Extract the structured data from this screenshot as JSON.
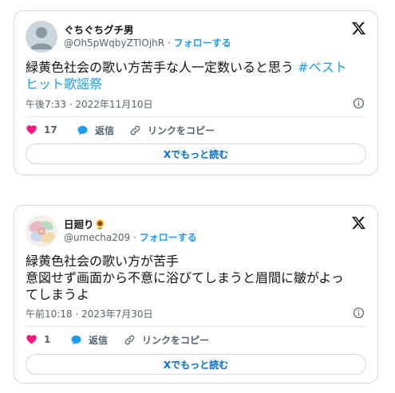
{
  "tweets": [
    {
      "name": "ぐちぐちグチ男",
      "handle": "@Oh5pWqbyZTlOjhR",
      "separator": "·",
      "follow_label": "フォローする",
      "text_line1": "緑黄色社会の歌い方苦手な人一定数いると思う ",
      "hashtag_part1": "#ベスト",
      "hashtag_part2": "ヒット歌謡祭",
      "timestamp": "午後7:33 · 2022年11月10日",
      "likes": "17",
      "reply_label": "返信",
      "copy_label": "リンクをコピー",
      "read_more": "Xでもっと読む"
    },
    {
      "name": "日廻り",
      "name_emoji": "🌻",
      "handle": "@umecha209",
      "separator": "·",
      "follow_label": "フォローする",
      "text_line1": "緑黄色社会の歌い方が苦手",
      "text_line2": "意図せず画面から不意に浴びてしまうと眉間に皺がよっ",
      "text_line3": "てしまうよ",
      "timestamp": "午前10:18 · 2023年7月30日",
      "likes": "1",
      "reply_label": "返信",
      "copy_label": "リンクをコピー",
      "read_more": "Xでもっと読む"
    }
  ],
  "colors": {
    "accent": "#1d9bf0",
    "like": "#f91880",
    "border": "#cfd9de",
    "muted": "#536471"
  },
  "icons": [
    "avatar-default",
    "x-logo-icon",
    "info-icon",
    "heart-icon",
    "reply-bubble-icon",
    "link-icon"
  ]
}
